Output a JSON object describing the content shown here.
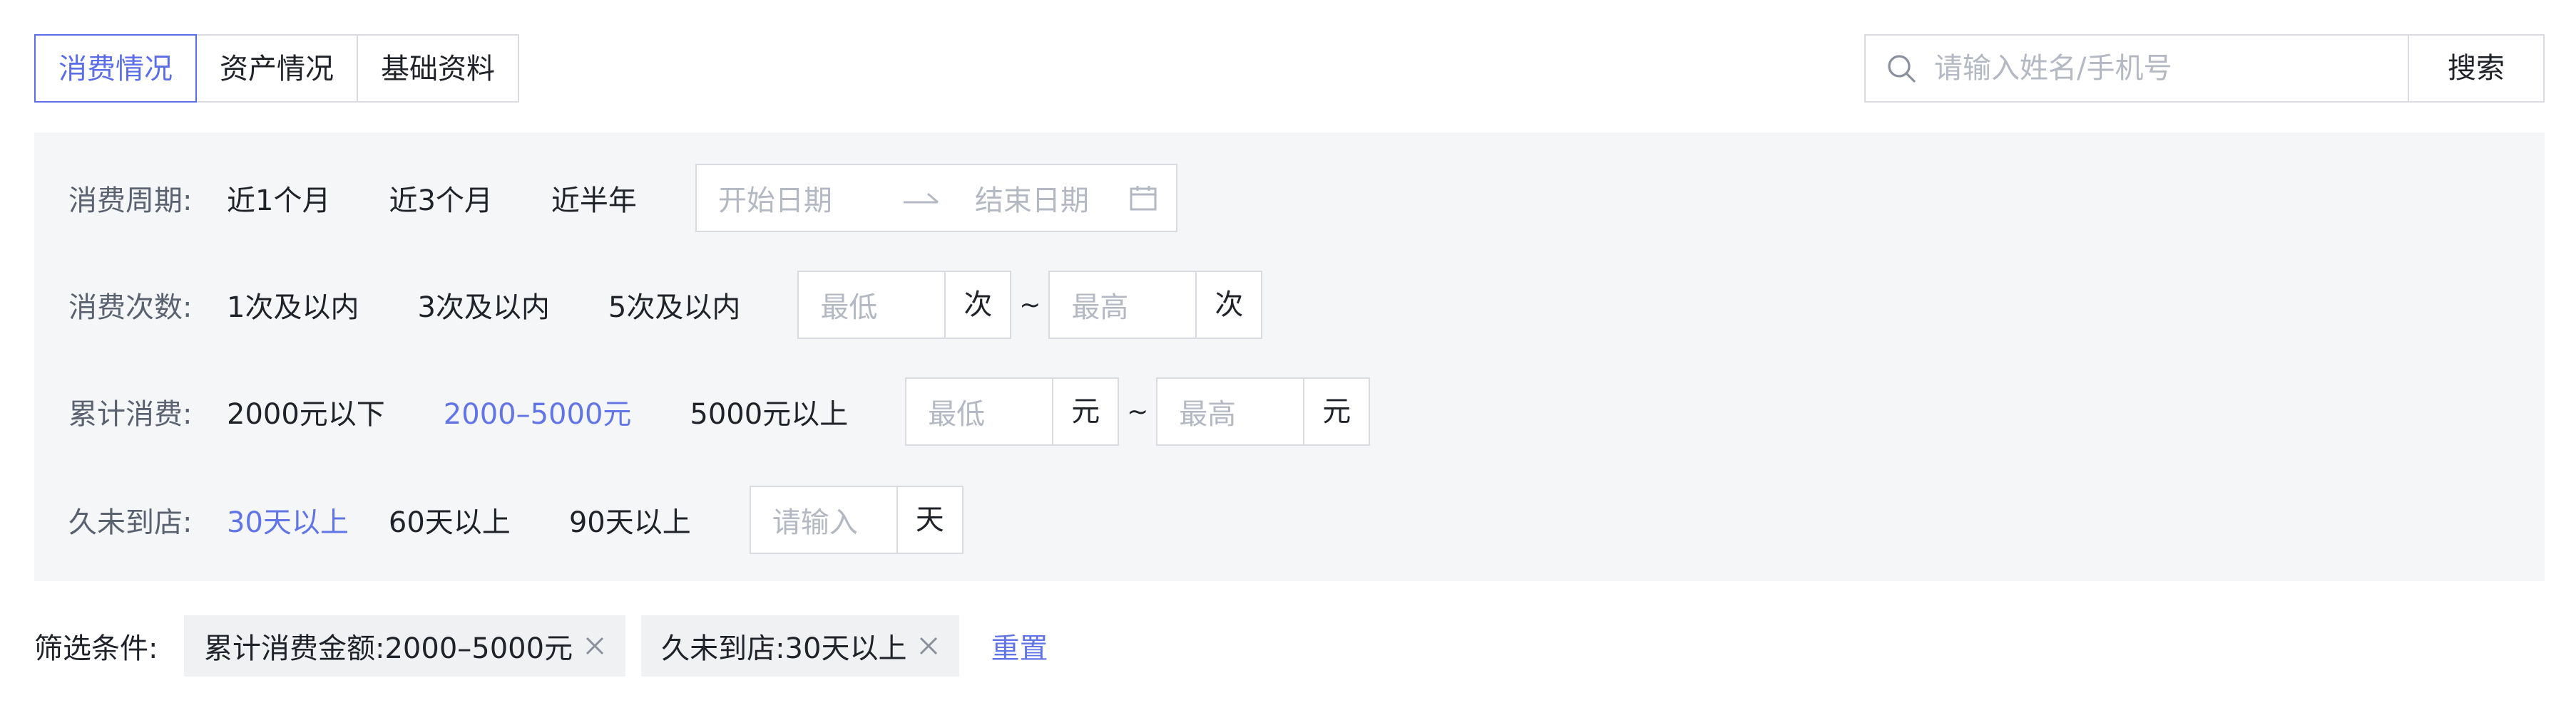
{
  "tabs": [
    {
      "label": "消费情况",
      "active": true
    },
    {
      "label": "资产情况",
      "active": false
    },
    {
      "label": "基础资料",
      "active": false
    }
  ],
  "search": {
    "placeholder": "请输入姓名/手机号",
    "button_label": "搜索",
    "icon": "search-icon"
  },
  "filters": {
    "period": {
      "label": "消费周期:",
      "options": [
        "近1个月",
        "近3个月",
        "近半年"
      ],
      "start_placeholder": "开始日期",
      "end_placeholder": "结束日期",
      "icons": [
        "arrow-right-icon",
        "calendar-icon"
      ]
    },
    "count": {
      "label": "消费次数:",
      "options": [
        "1次及以内",
        "3次及以内",
        "5次及以内"
      ],
      "min_placeholder": "最低",
      "max_placeholder": "最高",
      "unit": "次",
      "separator": "~"
    },
    "amount": {
      "label": "累计消费:",
      "options": [
        "2000元以下",
        "2000–5000元",
        "5000元以上"
      ],
      "selected_index": 1,
      "min_placeholder": "最低",
      "max_placeholder": "最高",
      "unit": "元",
      "separator": "~"
    },
    "absence": {
      "label": "久未到店:",
      "options": [
        "30天以上",
        "60天以上",
        "90天以上"
      ],
      "selected_index": 0,
      "input_placeholder": "请输入",
      "unit": "天"
    }
  },
  "conditions": {
    "label": "筛选条件:",
    "tags": [
      "累计消费金额:2000–5000元",
      "久未到店:30天以上"
    ],
    "reset_label": "重置"
  },
  "colors": {
    "accent": "#6275e6",
    "border": "#d9dbe0",
    "panel_bg": "#f5f6f8",
    "tag_bg": "#f0f1f3",
    "placeholder": "#b3b8c2"
  }
}
